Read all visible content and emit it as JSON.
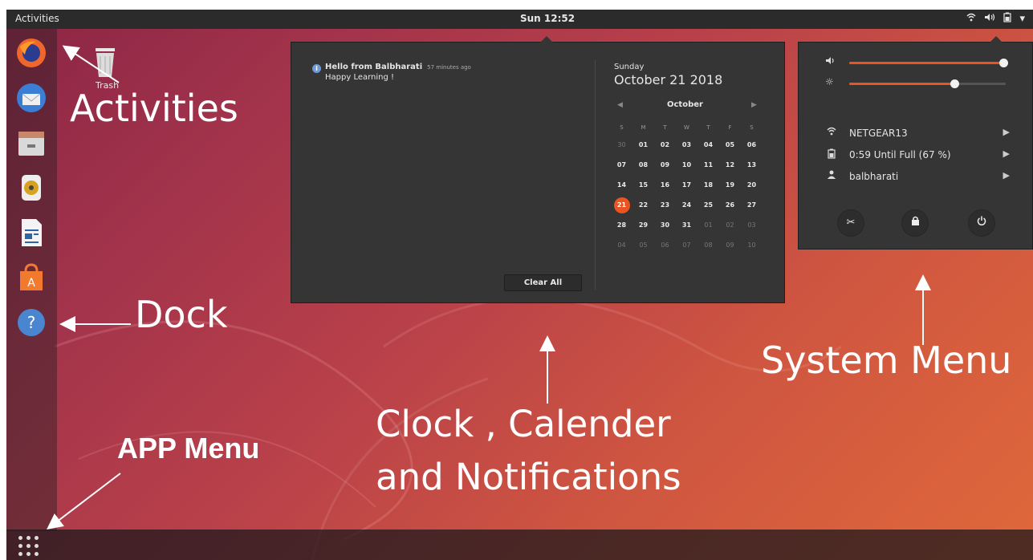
{
  "topbar": {
    "activities": "Activities",
    "clock": "Sun 12:52",
    "tray_icons": [
      "wifi-icon",
      "volume-icon",
      "battery-icon",
      "dropdown-icon"
    ]
  },
  "dock": {
    "apps": [
      "firefox-icon",
      "thunderbird-icon",
      "files-icon",
      "rhythmbox-icon",
      "libreoffice-writer-icon",
      "ubuntu-software-icon",
      "help-icon"
    ]
  },
  "desktop": {
    "trash_label": "Trash"
  },
  "calendar_popup": {
    "notification": {
      "title": "Hello from Balbharati",
      "time": "57 minutes ago",
      "body": "Happy Learning !"
    },
    "clear_all": "Clear All",
    "weekday": "Sunday",
    "date": "October 21 2018",
    "month": "October",
    "weekday_headers": [
      "S",
      "M",
      "T",
      "W",
      "T",
      "F",
      "S"
    ],
    "weeks": [
      [
        "30",
        "01",
        "02",
        "03",
        "04",
        "05",
        "06"
      ],
      [
        "07",
        "08",
        "09",
        "10",
        "11",
        "12",
        "13"
      ],
      [
        "14",
        "15",
        "16",
        "17",
        "18",
        "19",
        "20"
      ],
      [
        "21",
        "22",
        "23",
        "24",
        "25",
        "26",
        "27"
      ],
      [
        "28",
        "29",
        "30",
        "31",
        "01",
        "02",
        "03"
      ],
      [
        "04",
        "05",
        "06",
        "07",
        "08",
        "09",
        "10"
      ]
    ],
    "today": "21"
  },
  "system_menu": {
    "volume_level": 1.0,
    "brightness_level": 0.67,
    "wifi": "NETGEAR13",
    "battery": "0:59 Until Full (67 %)",
    "user": "balbharati",
    "buttons": [
      "settings-icon",
      "lock-icon",
      "power-icon"
    ]
  },
  "annotations": {
    "activities": "Activities",
    "dock": "Dock",
    "app_menu": "APP Menu",
    "clock_line1": "Clock , Calender",
    "clock_line2": "and Notifications",
    "system_menu": "System Menu"
  },
  "colors": {
    "accent": "#e95420",
    "panel": "#353535",
    "topbar": "#2c2b2b"
  }
}
